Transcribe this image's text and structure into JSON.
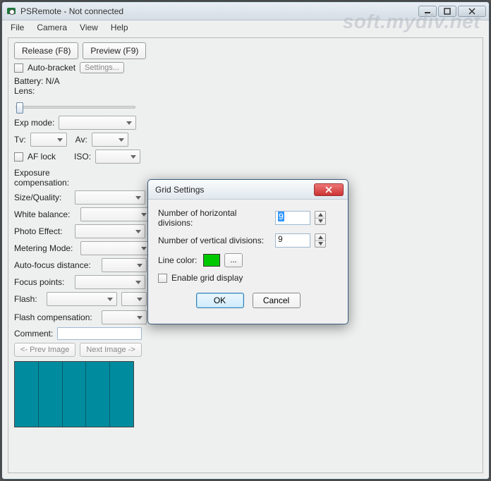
{
  "title": "PSRemote - Not connected",
  "menu": {
    "file": "File",
    "camera": "Camera",
    "view": "View",
    "help": "Help"
  },
  "watermark": "soft.mydiv.net",
  "toolbar": {
    "release": "Release (F8)",
    "preview": "Preview (F9)",
    "autobracket": "Auto-bracket",
    "settings": "Settings..."
  },
  "status": {
    "battery": "Battery: N/A",
    "lens": "Lens:"
  },
  "labels": {
    "expmode": "Exp mode:",
    "tv": "Tv:",
    "av": "Av:",
    "aflock": "AF lock",
    "iso": "ISO:",
    "expcomp": "Exposure compensation:",
    "sizequality": "Size/Quality:",
    "whitebalance": "White balance:",
    "photoeffect": "Photo Effect:",
    "metering": "Metering Mode:",
    "afdistance": "Auto-focus distance:",
    "focuspoints": "Focus points:",
    "flash": "Flash:",
    "flashcomp": "Flash compensation:",
    "comment": "Comment:"
  },
  "nav": {
    "prev": "<- Prev Image",
    "next": "Next Image ->"
  },
  "dialog": {
    "title": "Grid Settings",
    "hdiv_label": "Number of horizontal divisions:",
    "vdiv_label": "Number of vertical divisions:",
    "hdiv_value": "9",
    "vdiv_value": "9",
    "linecolor_label": "Line color:",
    "linecolor_value": "#00c800",
    "browse": "...",
    "enable": "Enable grid display",
    "ok": "OK",
    "cancel": "Cancel"
  }
}
